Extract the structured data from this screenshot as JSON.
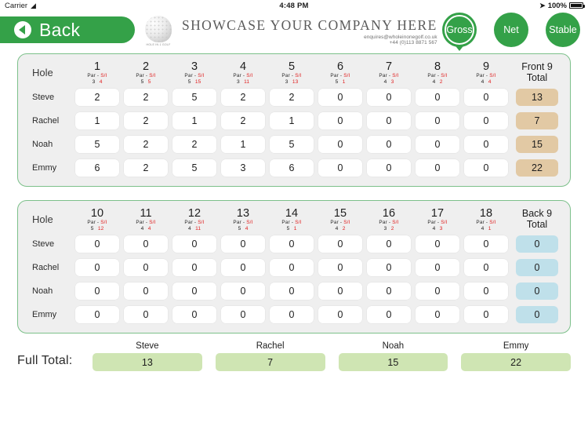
{
  "status_bar": {
    "carrier": "Carrier",
    "wifi_icon": "wifi-icon",
    "time": "4:48 PM",
    "location_icon": "location-arrow-icon",
    "battery_percent": "100%"
  },
  "header": {
    "back_label": "Back",
    "back_icon": "back-arrow-icon",
    "logo_icon": "golf-ball-icon",
    "logo_tagline": "HOLE IN 1 GOLF",
    "brand_title": "SHOWCASE YOUR COMPANY HERE",
    "brand_email": "enquires@wholeinonegolf.co.uk",
    "brand_phone": "+44 (0)113 8871 567",
    "modes": [
      {
        "label": "Gross",
        "selected": true
      },
      {
        "label": "Net",
        "selected": false
      },
      {
        "label": "Stable",
        "selected": false
      }
    ]
  },
  "colors": {
    "brand_green": "#34a148",
    "card_border": "#7cc08a",
    "card_bg": "#efefef",
    "front_total_bg": "#e2c9a4",
    "back_total_bg": "#bfe0ea",
    "full_total_bg": "#cfe5b3",
    "si_red": "#e02020"
  },
  "front_nine": {
    "hole_label": "Hole",
    "total_label_line1": "Front 9",
    "total_label_line2": "Total",
    "par_label": "Par",
    "si_label": "S/I",
    "separator": "-",
    "holes": [
      {
        "number": "1",
        "par": "3",
        "si": "4"
      },
      {
        "number": "2",
        "par": "5",
        "si": "5"
      },
      {
        "number": "3",
        "par": "5",
        "si": "15"
      },
      {
        "number": "4",
        "par": "3",
        "si": "11"
      },
      {
        "number": "5",
        "par": "3",
        "si": "13"
      },
      {
        "number": "6",
        "par": "5",
        "si": "1"
      },
      {
        "number": "7",
        "par": "4",
        "si": "3"
      },
      {
        "number": "8",
        "par": "4",
        "si": "2"
      },
      {
        "number": "9",
        "par": "4",
        "si": "4"
      }
    ],
    "players": [
      {
        "name": "Steve",
        "scores": [
          "2",
          "2",
          "5",
          "2",
          "2",
          "0",
          "0",
          "0",
          "0"
        ],
        "total": "13"
      },
      {
        "name": "Rachel",
        "scores": [
          "1",
          "2",
          "1",
          "2",
          "1",
          "0",
          "0",
          "0",
          "0"
        ],
        "total": "7"
      },
      {
        "name": "Noah",
        "scores": [
          "5",
          "2",
          "2",
          "1",
          "5",
          "0",
          "0",
          "0",
          "0"
        ],
        "total": "15"
      },
      {
        "name": "Emmy",
        "scores": [
          "6",
          "2",
          "5",
          "3",
          "6",
          "0",
          "0",
          "0",
          "0"
        ],
        "total": "22"
      }
    ]
  },
  "back_nine": {
    "hole_label": "Hole",
    "total_label_line1": "Back 9",
    "total_label_line2": "Total",
    "par_label": "Par",
    "si_label": "S/I",
    "separator": "-",
    "holes": [
      {
        "number": "10",
        "par": "5",
        "si": "12"
      },
      {
        "number": "11",
        "par": "4",
        "si": "4"
      },
      {
        "number": "12",
        "par": "4",
        "si": "11"
      },
      {
        "number": "13",
        "par": "5",
        "si": "4"
      },
      {
        "number": "14",
        "par": "5",
        "si": "1"
      },
      {
        "number": "15",
        "par": "4",
        "si": "2"
      },
      {
        "number": "16",
        "par": "3",
        "si": "2"
      },
      {
        "number": "17",
        "par": "4",
        "si": "3"
      },
      {
        "number": "18",
        "par": "4",
        "si": "1"
      }
    ],
    "players": [
      {
        "name": "Steve",
        "scores": [
          "0",
          "0",
          "0",
          "0",
          "0",
          "0",
          "0",
          "0",
          "0"
        ],
        "total": "0"
      },
      {
        "name": "Rachel",
        "scores": [
          "0",
          "0",
          "0",
          "0",
          "0",
          "0",
          "0",
          "0",
          "0"
        ],
        "total": "0"
      },
      {
        "name": "Noah",
        "scores": [
          "0",
          "0",
          "0",
          "0",
          "0",
          "0",
          "0",
          "0",
          "0"
        ],
        "total": "0"
      },
      {
        "name": "Emmy",
        "scores": [
          "0",
          "0",
          "0",
          "0",
          "0",
          "0",
          "0",
          "0",
          "0"
        ],
        "total": "0"
      }
    ]
  },
  "footer": {
    "label": "Full Total:",
    "columns": [
      {
        "name": "Steve",
        "total": "13"
      },
      {
        "name": "Rachel",
        "total": "7"
      },
      {
        "name": "Noah",
        "total": "15"
      },
      {
        "name": "Emmy",
        "total": "22"
      }
    ]
  }
}
